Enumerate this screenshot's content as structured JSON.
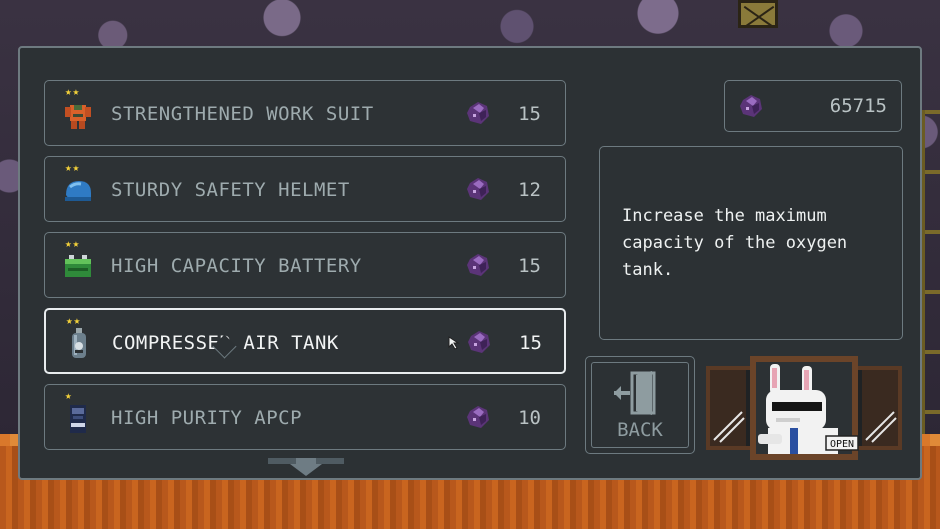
{
  "currency": {
    "amount": "65715",
    "icon": "purple-gem-icon"
  },
  "description": {
    "text": "Increase the maximum capacity of the oxygen tank."
  },
  "items": [
    {
      "name": "STRENGTHENED WORK SUIT",
      "stars": "★★",
      "price": "15",
      "icon": "work-suit-icon",
      "selected": false
    },
    {
      "name": "STURDY SAFETY HELMET",
      "stars": "★★",
      "price": "12",
      "icon": "helmet-icon",
      "selected": false
    },
    {
      "name": "HIGH CAPACITY BATTERY",
      "stars": "★★",
      "price": "15",
      "icon": "battery-icon",
      "selected": false
    },
    {
      "name": "COMPRESSED AIR TANK",
      "stars": "★★",
      "price": "15",
      "icon": "air-tank-icon",
      "selected": true
    },
    {
      "name": "HIGH PURITY APCP",
      "stars": "★",
      "price": "10",
      "icon": "apcp-fuel-icon",
      "selected": false
    }
  ],
  "back_button": {
    "label": "BACK",
    "icon": "exit-door-icon"
  },
  "shopkeeper": {
    "sign_label": "OPEN"
  },
  "colors": {
    "star": "#f4d23a",
    "gem": "#6b3f8a",
    "panel": "#2c3134",
    "border": "#6d7a80"
  }
}
